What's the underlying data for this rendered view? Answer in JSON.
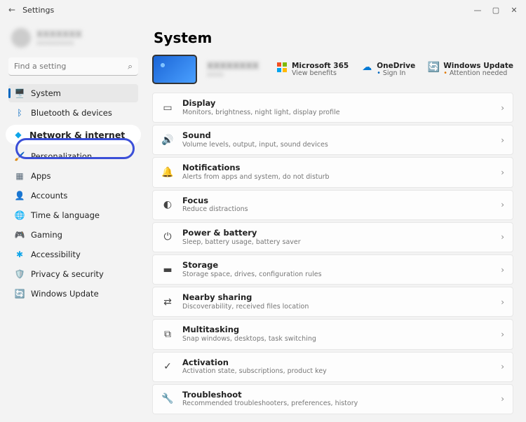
{
  "titlebar": {
    "app_name": "Settings"
  },
  "search": {
    "placeholder": "Find a setting"
  },
  "nav": {
    "items": [
      {
        "key": "system",
        "label": "System",
        "icon": "🖥️",
        "color": "#0067c0"
      },
      {
        "key": "bluetooth",
        "label": "Bluetooth & devices",
        "icon": "ᛒ",
        "color": "#0067c0"
      },
      {
        "key": "network",
        "label": "Network & internet",
        "icon": "◆",
        "color": "#0ea5e9"
      },
      {
        "key": "personalization",
        "label": "Personalization",
        "icon": "🖌️",
        "color": "#a26b3e"
      },
      {
        "key": "apps",
        "label": "Apps",
        "icon": "▦",
        "color": "#5b6b7a"
      },
      {
        "key": "accounts",
        "label": "Accounts",
        "icon": "👤",
        "color": "#16a085"
      },
      {
        "key": "time",
        "label": "Time & language",
        "icon": "🌐",
        "color": "#0078d4"
      },
      {
        "key": "gaming",
        "label": "Gaming",
        "icon": "🎮",
        "color": "#555"
      },
      {
        "key": "accessibility",
        "label": "Accessibility",
        "icon": "✱",
        "color": "#0ea5e9"
      },
      {
        "key": "privacy",
        "label": "Privacy & security",
        "icon": "🛡️",
        "color": "#777"
      },
      {
        "key": "update",
        "label": "Windows Update",
        "icon": "🔄",
        "color": "#0ea5e9"
      }
    ],
    "active_key": "system",
    "highlighted_key": "network"
  },
  "main": {
    "title": "System",
    "status": [
      {
        "key": "m365",
        "title": "Microsoft 365",
        "sub": "View benefits"
      },
      {
        "key": "onedrive",
        "title": "OneDrive",
        "sub": "Sign In",
        "bullet": "blue"
      },
      {
        "key": "winupdate",
        "title": "Windows Update",
        "sub": "Attention needed",
        "bullet": "orange"
      }
    ],
    "rows": [
      {
        "key": "display",
        "title": "Display",
        "sub": "Monitors, brightness, night light, display profile",
        "icon": "▭"
      },
      {
        "key": "sound",
        "title": "Sound",
        "sub": "Volume levels, output, input, sound devices",
        "icon": "🔊"
      },
      {
        "key": "notifications",
        "title": "Notifications",
        "sub": "Alerts from apps and system, do not disturb",
        "icon": "🔔"
      },
      {
        "key": "focus",
        "title": "Focus",
        "sub": "Reduce distractions",
        "icon": "◐"
      },
      {
        "key": "power",
        "title": "Power & battery",
        "sub": "Sleep, battery usage, battery saver",
        "icon": "⏻"
      },
      {
        "key": "storage",
        "title": "Storage",
        "sub": "Storage space, drives, configuration rules",
        "icon": "▬"
      },
      {
        "key": "nearby",
        "title": "Nearby sharing",
        "sub": "Discoverability, received files location",
        "icon": "⇄"
      },
      {
        "key": "multitask",
        "title": "Multitasking",
        "sub": "Snap windows, desktops, task switching",
        "icon": "⧉"
      },
      {
        "key": "activation",
        "title": "Activation",
        "sub": "Activation state, subscriptions, product key",
        "icon": "✓"
      },
      {
        "key": "troubleshoot",
        "title": "Troubleshoot",
        "sub": "Recommended troubleshooters, preferences, history",
        "icon": "🔧"
      }
    ]
  }
}
